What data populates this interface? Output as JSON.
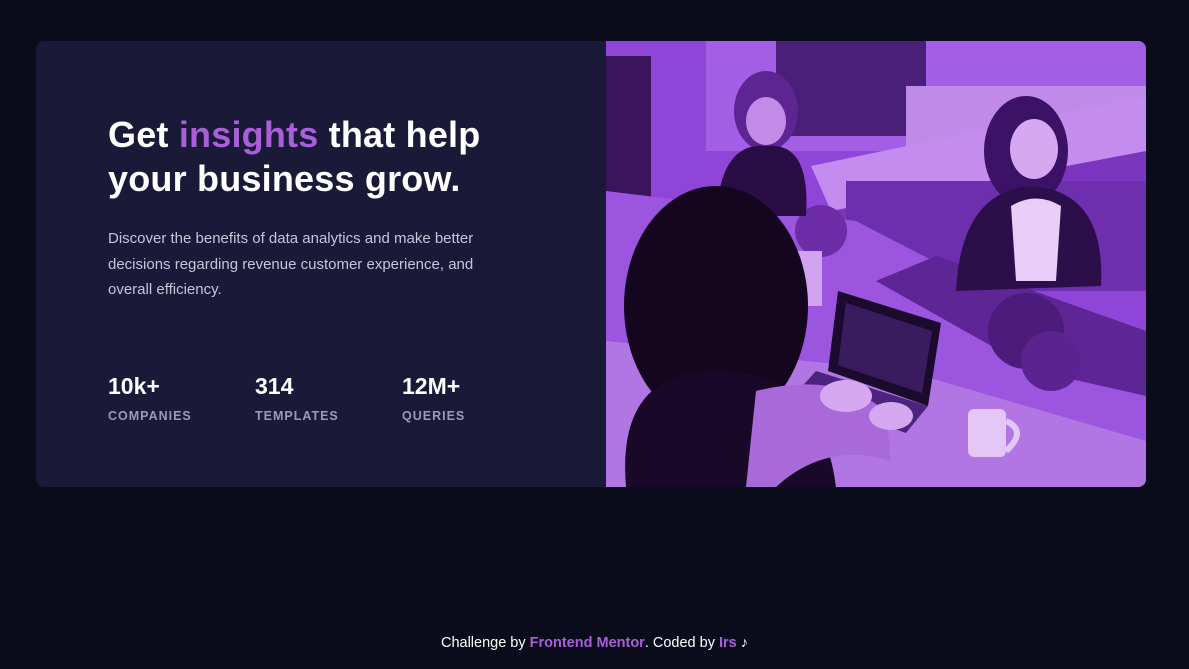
{
  "hero": {
    "headline_before": "Get ",
    "headline_accent": "insights",
    "headline_after": " that help your business grow.",
    "description": "Discover the benefits of data analytics and make better decisions regarding revenue customer experience, and overall efficiency.",
    "stats": [
      {
        "value": "10k+",
        "label": "COMPANIES"
      },
      {
        "value": "314",
        "label": "TEMPLATES"
      },
      {
        "value": "12M+",
        "label": "QUERIES"
      }
    ]
  },
  "footer": {
    "prefix": "Challenge by ",
    "challenge_link": "Frontend Mentor",
    "middle": ". Coded by ",
    "author_link": "Irs",
    "suffix": " ♪"
  },
  "colors": {
    "page_background": "#0a0c1c",
    "card_background": "#1b1938",
    "accent": "#a85fd8",
    "image_tint": "#8b3fd6"
  }
}
